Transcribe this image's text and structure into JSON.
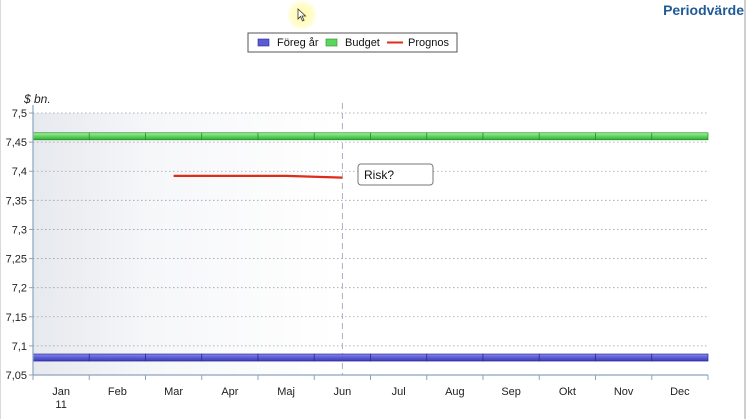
{
  "page": {
    "title": "Periodvärde"
  },
  "colors": {
    "prior_year": "#5b5bd6",
    "budget": "#5dd65d",
    "forecast": "#e02a1a",
    "title": "#1f5a96"
  },
  "chart_data": {
    "type": "line",
    "ylabel": "$ bn.",
    "xlabel": "",
    "categories": [
      "Jan",
      "Feb",
      "Mar",
      "Apr",
      "Maj",
      "Jun",
      "Jul",
      "Aug",
      "Sep",
      "Okt",
      "Nov",
      "Dec"
    ],
    "x_sublabel": "11",
    "ylim": [
      7.05,
      7.5
    ],
    "yticks": [
      "7,05",
      "7,1",
      "7,15",
      "7,2",
      "7,25",
      "7,3",
      "7,35",
      "7,4",
      "7,45",
      "7,5"
    ],
    "ytick_values": [
      7.05,
      7.1,
      7.15,
      7.2,
      7.25,
      7.3,
      7.35,
      7.4,
      7.45,
      7.5
    ],
    "grid": true,
    "legend_position": "top-center",
    "series": [
      {
        "name": "Föreg år",
        "style": "band",
        "values": [
          7.08,
          7.08,
          7.08,
          7.08,
          7.08,
          7.08,
          7.08,
          7.08,
          7.08,
          7.08,
          7.08,
          7.08
        ]
      },
      {
        "name": "Budget",
        "style": "band",
        "values": [
          7.46,
          7.46,
          7.46,
          7.46,
          7.46,
          7.46,
          7.46,
          7.46,
          7.46,
          7.46,
          7.46,
          7.46
        ]
      },
      {
        "name": "Prognos",
        "style": "line",
        "values": [
          null,
          null,
          7.392,
          7.392,
          7.392,
          7.389,
          null,
          null,
          null,
          null,
          null,
          null
        ]
      }
    ],
    "annotation": {
      "text": "Risk?",
      "anchor_category": "Jun"
    }
  }
}
